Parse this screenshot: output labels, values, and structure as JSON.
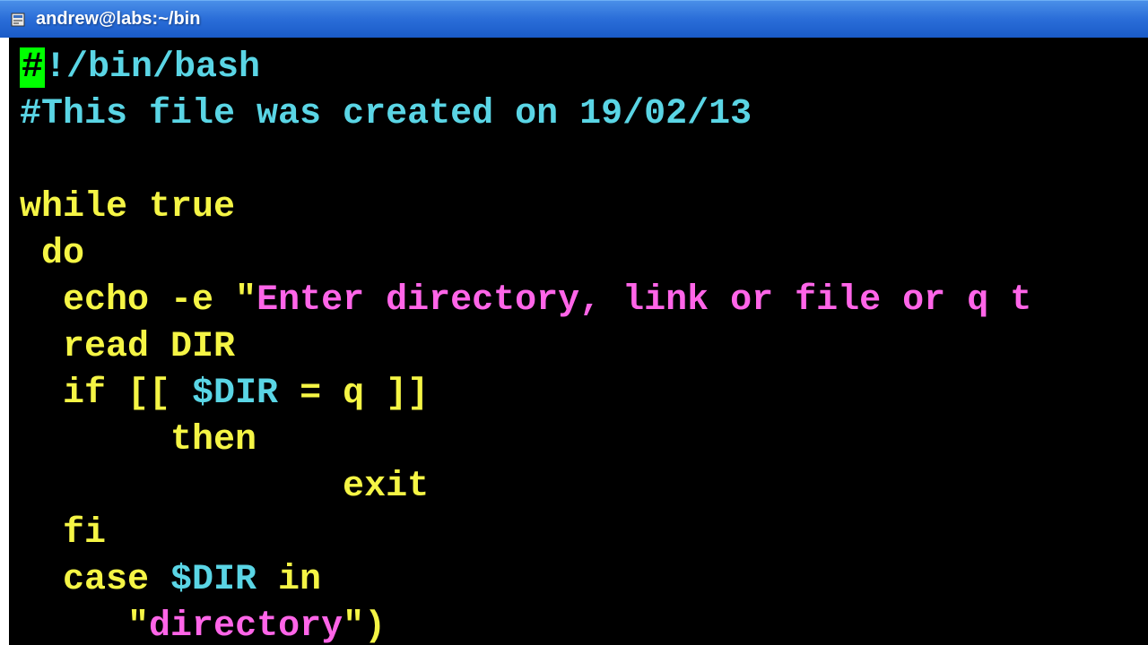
{
  "window": {
    "title": "andrew@labs:~/bin"
  },
  "code": {
    "line1_cursor": "#",
    "line1_rest": "!/bin/bash",
    "line2": "#This file was created on 19/02/13",
    "line3": "",
    "line4_kw": "while true",
    "line5": " do",
    "line6_cmd": "  echo -e ",
    "line6_quote": "\"",
    "line6_str": "Enter directory, link or file or q t",
    "line7_cmd": "  read ",
    "line7_arg": "DIR",
    "line8_if": "  if ",
    "line8_open": "[[ ",
    "line8_var": "$DIR",
    "line8_rest": " = q ]]",
    "line9": "       then",
    "line10": "               exit",
    "line11": "  fi",
    "line12_case": "  case ",
    "line12_var": "$DIR",
    "line12_in": " in",
    "line13_indent": "     ",
    "line13_quote1": "\"",
    "line13_str": "directory",
    "line13_quote2": "\"",
    "line13_paren": ")"
  }
}
